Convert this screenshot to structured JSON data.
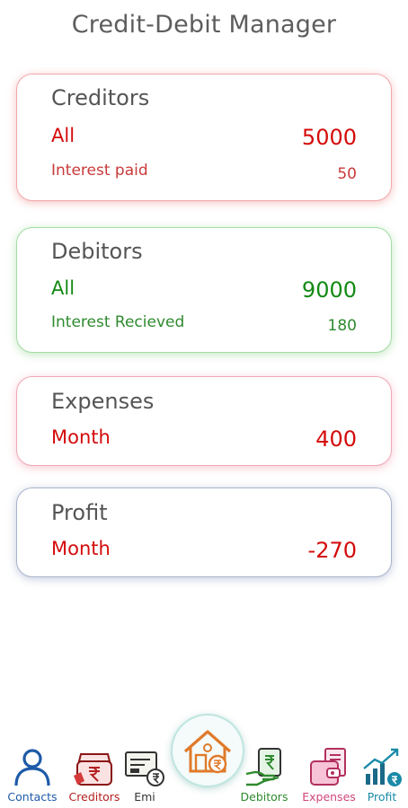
{
  "app": {
    "title": "Credit-Debit Manager"
  },
  "cards": {
    "creditors": {
      "title": "Creditors",
      "label": "All",
      "value": "5000",
      "sub_label": "Interest paid",
      "sub_value": "50"
    },
    "debitors": {
      "title": "Debitors",
      "label": "All",
      "value": "9000",
      "sub_label": "Interest Recieved",
      "sub_value": "180"
    },
    "expenses": {
      "title": "Expenses",
      "label": "Month",
      "value": "400"
    },
    "profit": {
      "title": "Profit",
      "label": "Month",
      "value": "-270"
    }
  },
  "nav": {
    "contacts": {
      "label": "Contacts",
      "icon": "person-icon"
    },
    "creditors": {
      "label": "Creditors",
      "icon": "rupee-bag-icon"
    },
    "emi": {
      "label": "Emi",
      "icon": "emi-card-icon"
    },
    "home": {
      "icon": "house-rupee-icon"
    },
    "debitors": {
      "label": "Debitors",
      "icon": "rupee-hand-icon"
    },
    "expenses": {
      "label": "Expenses",
      "icon": "wallet-bill-icon"
    },
    "profit": {
      "label": "Profit",
      "icon": "growth-chart-icon"
    }
  },
  "colors": {
    "creditors": "#d40b0b",
    "debitors": "#138a13",
    "expenses": "#d40b0b",
    "profit": "#d40b0b",
    "contacts_nav": "#1e5aa8",
    "creditors_nav": "#b32020",
    "debitors_nav": "#2e8a2e",
    "expenses_nav": "#d0457a",
    "profit_nav": "#1a8aa8"
  }
}
